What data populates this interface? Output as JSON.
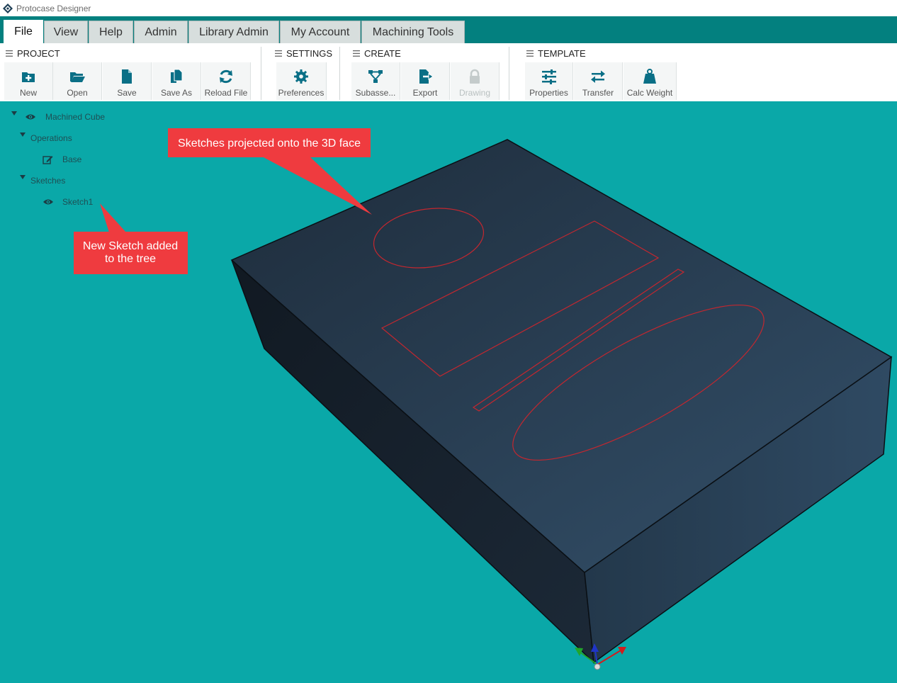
{
  "window": {
    "title": "Protocase Designer"
  },
  "menu": {
    "tabs": [
      {
        "label": "File",
        "active": true
      },
      {
        "label": "View"
      },
      {
        "label": "Help"
      },
      {
        "label": "Admin"
      },
      {
        "label": "Library Admin"
      },
      {
        "label": "My Account"
      },
      {
        "label": "Machining Tools"
      }
    ]
  },
  "ribbon": {
    "groups": {
      "project": "PROJECT",
      "settings": "SETTINGS",
      "create": "CREATE",
      "template": "TEMPLATE"
    },
    "buttons": {
      "new": "New",
      "open": "Open",
      "save": "Save",
      "save_as": "Save As",
      "reload_file": "Reload File",
      "preferences": "Preferences",
      "subassembly": "Subasse...",
      "export": "Export",
      "drawing": "Drawing",
      "properties": "Properties",
      "transfer": "Transfer",
      "calc_weight": "Calc Weight"
    }
  },
  "tree": {
    "root": "Machined Cube",
    "operations": "Operations",
    "operation_base": "Base",
    "sketches": "Sketches",
    "sketch1": "Sketch1"
  },
  "callouts": {
    "top_text": "Sketches projected onto the 3D face",
    "left_line1": "New Sketch added",
    "left_line2": "to the tree"
  },
  "colors": {
    "accent": "#03807f",
    "viewport_background": "#0aa8a8",
    "ribbon_icon": "#0a6f86",
    "callout": "#ef3b3f",
    "sketch_lines": "#c3272f"
  }
}
